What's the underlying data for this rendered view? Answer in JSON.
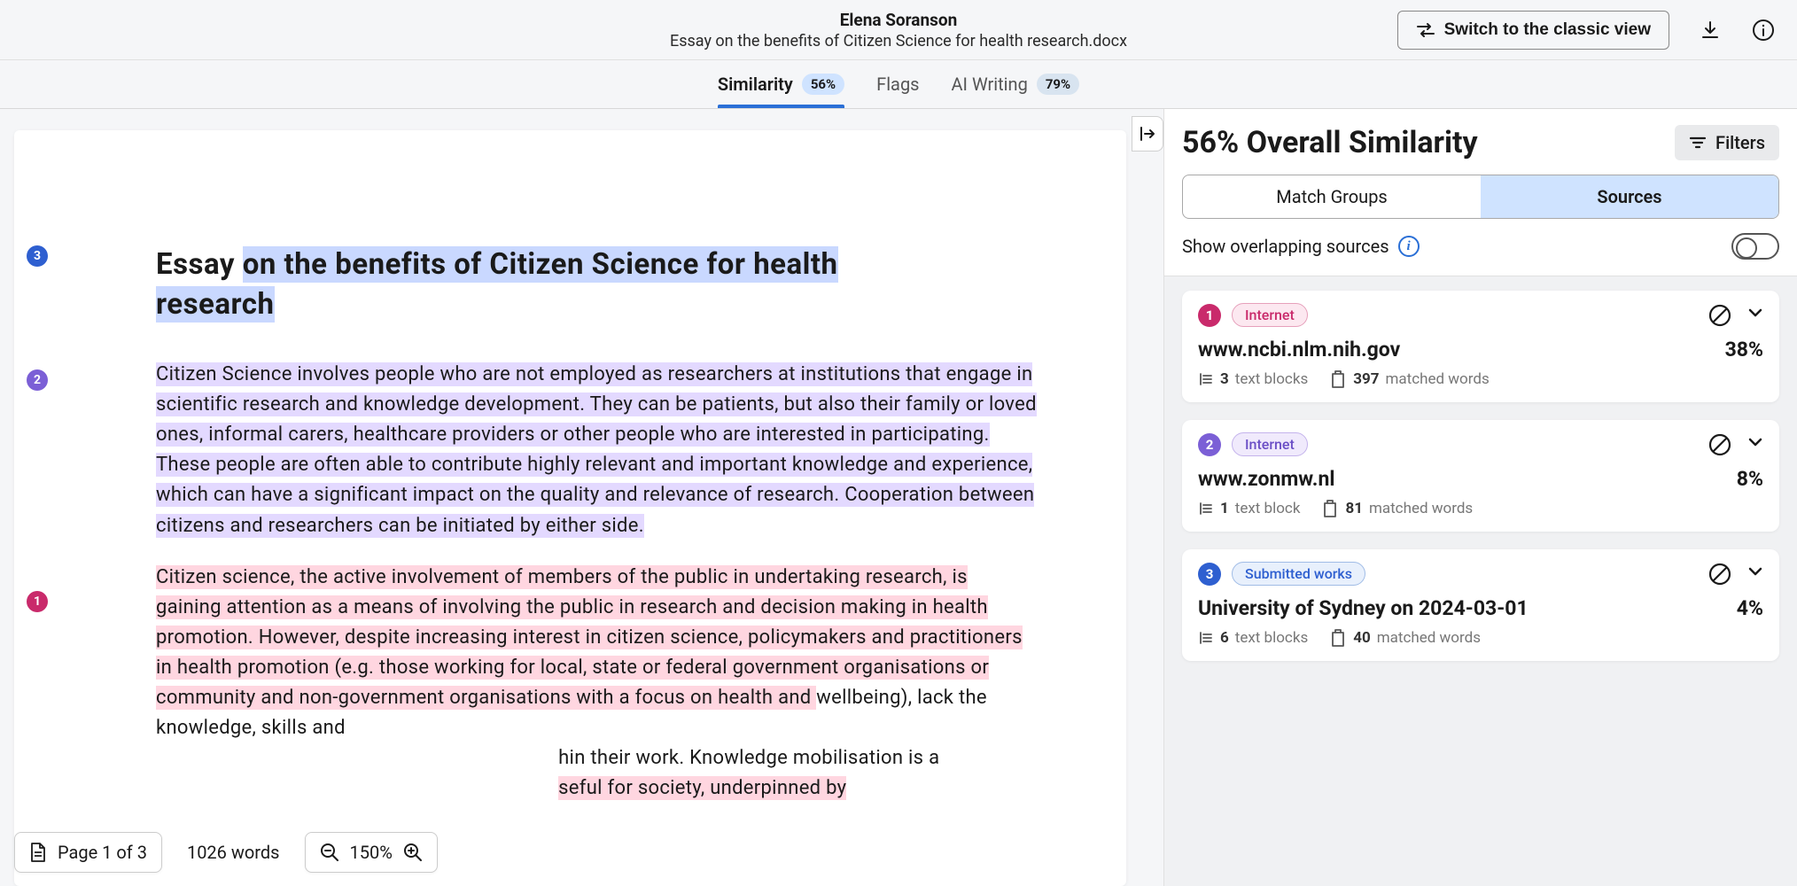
{
  "header": {
    "author": "Elena Soranson",
    "filename": "Essay on the benefits of Citizen Science for health research.docx",
    "classic_view_label": "Switch to the classic view"
  },
  "tabs": {
    "similarity": {
      "label": "Similarity",
      "badge": "56%"
    },
    "flags": {
      "label": "Flags"
    },
    "ai": {
      "label": "AI Writing",
      "badge": "79%"
    }
  },
  "document": {
    "title_a": "Essay ",
    "title_b": "on the benefits of Citizen Science for health",
    "title_c": "research",
    "p1_a": "Citizen Science involves people who are not employed as researchers at institutions that engage in scientific research and knowledge development. They can be patients, but also their family or loved ones, informal carers, healthcare providers or other people who are interested in participating. These people are often able to contribute highly relevant and important knowledge and experience, which can have a significant impact on the quality and relevance of research. Cooperation between citizens and researchers can be initiated by either side.",
    "p2_a": "Citizen science, the active involvement of members of the public in undertaking research, is gaining attention as a means of involving the public in research and decision making in health promotion. However, despite increasing interest in citizen science, policymakers and practitioners in health promotion (e.g. those working for local, state or federal government organisations or community and non-government organisations with a focus on health and ",
    "p2_b": "wellbeing), lack the knowledge, skills and ",
    "p2_c": "hin their work. Knowledge mobilisation is a ",
    "p2_d": "seful for society, underpinned by ",
    "margin_3": "3",
    "margin_2": "2",
    "margin_1": "1"
  },
  "toolbar": {
    "page_label": "Page 1 of 3",
    "word_count": "1026 words",
    "zoom": "150%"
  },
  "sidebar": {
    "overall_title": "56% Overall Similarity",
    "filters_label": "Filters",
    "seg_matchgroups": "Match Groups",
    "seg_sources": "Sources",
    "overlap_label": "Show overlapping sources"
  },
  "sources": [
    {
      "num": "1",
      "type": "Internet",
      "url": "www.ncbi.nlm.nih.gov",
      "pct": "38%",
      "blocks_num": "3",
      "blocks_label": "text blocks",
      "words_num": "397",
      "words_label": "matched words"
    },
    {
      "num": "2",
      "type": "Internet",
      "url": "www.zonmw.nl",
      "pct": "8%",
      "blocks_num": "1",
      "blocks_label": "text block",
      "words_num": "81",
      "words_label": "matched words"
    },
    {
      "num": "3",
      "type": "Submitted works",
      "url": "University of Sydney on 2024-03-01",
      "pct": "4%",
      "blocks_num": "6",
      "blocks_label": "text blocks",
      "words_num": "40",
      "words_label": "matched words"
    }
  ]
}
